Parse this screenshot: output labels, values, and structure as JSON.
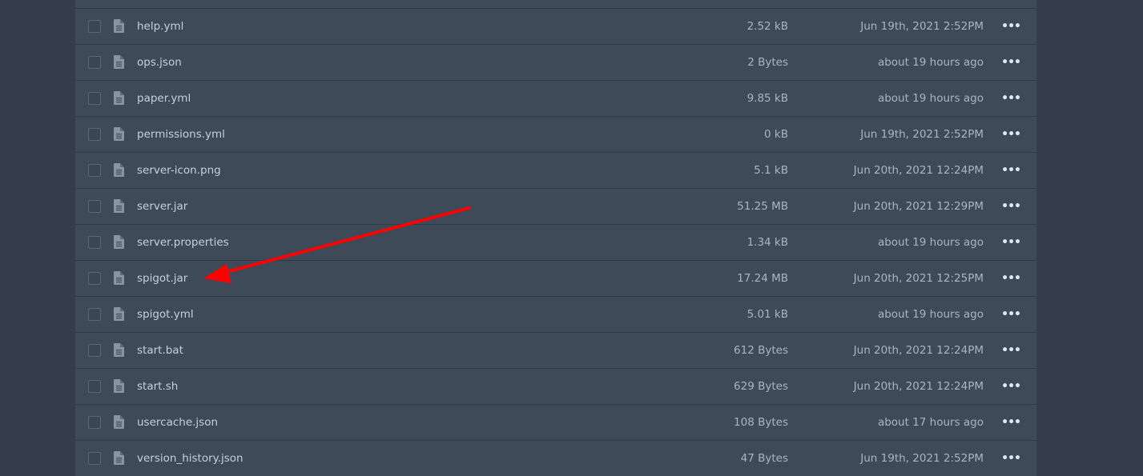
{
  "files": [
    {
      "name": "",
      "size": "",
      "date": ""
    },
    {
      "name": "help.yml",
      "size": "2.52 kB",
      "date": "Jun 19th, 2021 2:52PM"
    },
    {
      "name": "ops.json",
      "size": "2 Bytes",
      "date": "about 19 hours ago"
    },
    {
      "name": "paper.yml",
      "size": "9.85 kB",
      "date": "about 19 hours ago"
    },
    {
      "name": "permissions.yml",
      "size": "0 kB",
      "date": "Jun 19th, 2021 2:52PM"
    },
    {
      "name": "server-icon.png",
      "size": "5.1 kB",
      "date": "Jun 20th, 2021 12:24PM"
    },
    {
      "name": "server.jar",
      "size": "51.25 MB",
      "date": "Jun 20th, 2021 12:29PM"
    },
    {
      "name": "server.properties",
      "size": "1.34 kB",
      "date": "about 19 hours ago"
    },
    {
      "name": "spigot.jar",
      "size": "17.24 MB",
      "date": "Jun 20th, 2021 12:25PM"
    },
    {
      "name": "spigot.yml",
      "size": "5.01 kB",
      "date": "about 19 hours ago"
    },
    {
      "name": "start.bat",
      "size": "612 Bytes",
      "date": "Jun 20th, 2021 12:24PM"
    },
    {
      "name": "start.sh",
      "size": "629 Bytes",
      "date": "Jun 20th, 2021 12:24PM"
    },
    {
      "name": "usercache.json",
      "size": "108 Bytes",
      "date": "about 17 hours ago"
    },
    {
      "name": "version_history.json",
      "size": "47 Bytes",
      "date": "Jun 19th, 2021 2:52PM"
    }
  ],
  "more_label": "•••",
  "annotation": {
    "color": "#ff0000",
    "points_to": "spigot.jar"
  }
}
